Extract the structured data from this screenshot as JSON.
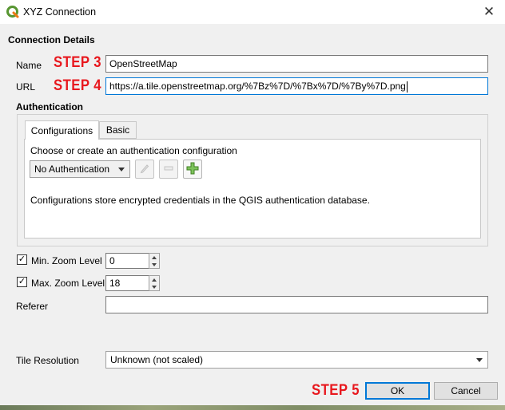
{
  "window": {
    "title": "XYZ Connection",
    "close_glyph": "✕"
  },
  "connection": {
    "section_title": "Connection Details",
    "name_label": "Name",
    "name_value": "OpenStreetMap",
    "url_label": "URL",
    "url_value": "https://a.tile.openstreetmap.org/%7Bz%7D/%7Bx%7D/%7By%7D.png"
  },
  "annotations": {
    "step3": "STEP 3",
    "step4": "STEP 4",
    "step5": "STEP 5"
  },
  "authentication": {
    "section_title": "Authentication",
    "tabs": [
      "Configurations",
      "Basic"
    ],
    "active_tab": "Configurations",
    "prompt": "Choose or create an authentication configuration",
    "selected_config": "No Authentication",
    "info": "Configurations store encrypted credentials in the QGIS authentication database."
  },
  "zoom": {
    "min_label": "Min. Zoom Level",
    "min_checked": true,
    "min_value": "0",
    "max_label": "Max. Zoom Level",
    "max_checked": true,
    "max_value": "18"
  },
  "referer": {
    "label": "Referer",
    "value": ""
  },
  "tile_resolution": {
    "label": "Tile Resolution",
    "value": "Unknown (not scaled)"
  },
  "buttons": {
    "ok": "OK",
    "cancel": "Cancel"
  },
  "colors": {
    "step_annotation": "#e8181e",
    "focus_border": "#0078d7",
    "qgis_green": "#589632"
  },
  "icons": {
    "app": "qgis-logo-icon",
    "edit": "pencil-icon",
    "remove": "remove-icon",
    "add": "add-icon"
  }
}
